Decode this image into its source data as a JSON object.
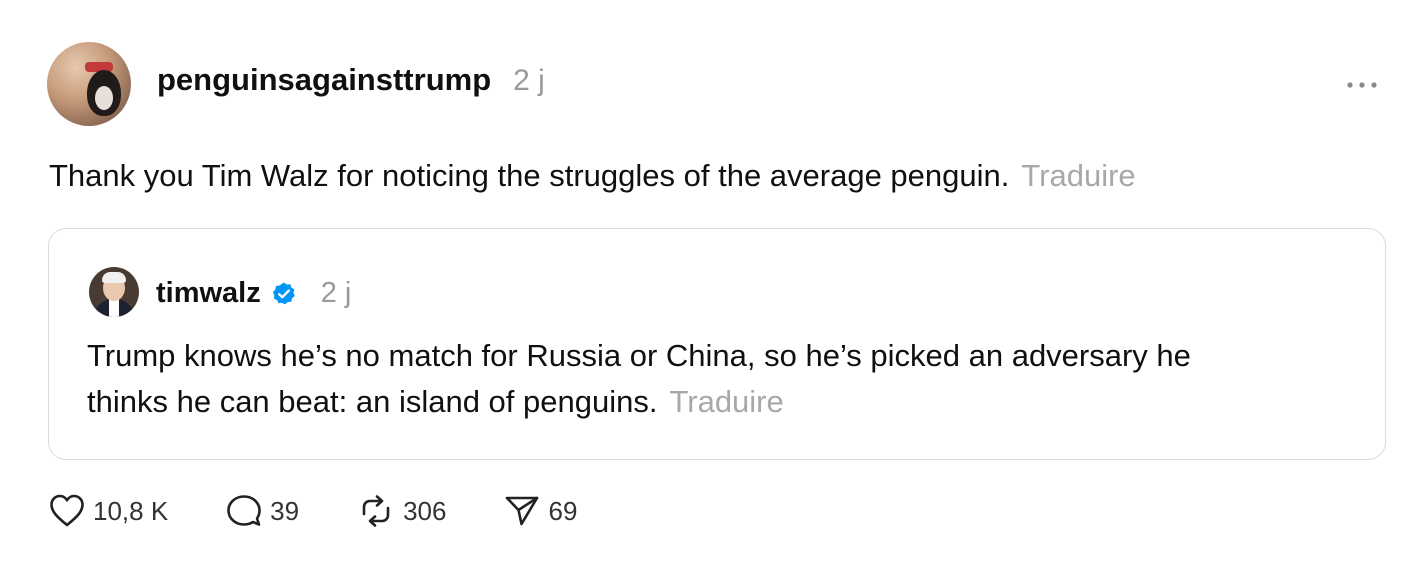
{
  "post": {
    "username": "penguinsagainsttrump",
    "time": "2 j",
    "text": "Thank you Tim Walz for noticing the struggles of the average penguin.",
    "translate_label": "Traduire",
    "avatar_icon": "penguin-avatar"
  },
  "quote": {
    "username": "timwalz",
    "verified": true,
    "time": "2 j",
    "text_line1": "Trump knows he’s no match for Russia or China, so he’s picked an adversary he",
    "text_line2": "thinks he can beat: an island of penguins.",
    "translate_label": "Traduire",
    "verified_color": "#0095f6"
  },
  "actions": {
    "likes": "10,8 K",
    "replies": "39",
    "reposts": "306",
    "shares": "69"
  },
  "icons": {
    "more": "more-horizontal-icon",
    "like": "heart-icon",
    "reply": "comment-icon",
    "repost": "repost-icon",
    "share": "send-icon"
  }
}
